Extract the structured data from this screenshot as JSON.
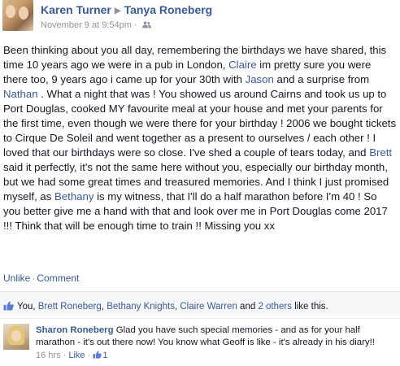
{
  "post": {
    "author": "Karen Turner",
    "target": "Tanya Roneberg",
    "arrow": "▶",
    "timestamp": "November 9 at 9:54pm",
    "meta_sep": " · ",
    "audience_icon": "friends-icon",
    "body": {
      "t1": "Been thinking about you all day, remembering the birthdays we have shared, this time 10 years ago we were in a pub in London, ",
      "tag1": "Claire",
      "t2": " im pretty sure you were there too, 9 years ago i came up for your 30th with ",
      "tag2": "Jason",
      "t3": " and a surprise from ",
      "tag3": "Nathan",
      "t4": " . What a night that was ! You showed us around Cairns and took us up to Port Douglas, cooked MY favourite meal at your house and met your parents for the first time, even though we were there for your birthday ! 2006 we bought tickets to Cirque De Soleil and went together as a present to ourselves / each other ! I loved that our birthdays were so close. I've shed a couple of tears today, and ",
      "tag4": "Brett",
      "t5": " said it perfectly, it's not the same here without you, especially our birthday month, but we had some great times and treasured memories. And I think I just promised myself, as ",
      "tag5": "Bethany",
      "t6": " is my witness, that I'll do a half marathon before I'm 40 ! So you better give me a hand with that and look over me in Port Douglas come 2017 !!! Think that will be enough time to train !! Missing you xx"
    },
    "actions": {
      "unlike": "Unlike",
      "sep": "·",
      "comment": "Comment"
    }
  },
  "likes": {
    "thumb_icon": "thumbs-up-icon",
    "you": "You, ",
    "p1": "Brett Roneberg",
    "c1": ", ",
    "p2": "Bethany Knights",
    "c2": ", ",
    "p3": "Claire Warren",
    "and": " and ",
    "others": "2 others",
    "suffix": " like this."
  },
  "comment": {
    "author": "Sharon Roneberg",
    "text": " Glad you have such special memories - and as for your half marathon - it's out there now! You know what Geoff is like - it's already in his diary!!",
    "time": "16 hrs",
    "sep1": " · ",
    "like": "Like",
    "sep2": " · ",
    "like_count": "1",
    "colors": {
      "link": "#3b5998",
      "muted": "#90949c"
    }
  }
}
